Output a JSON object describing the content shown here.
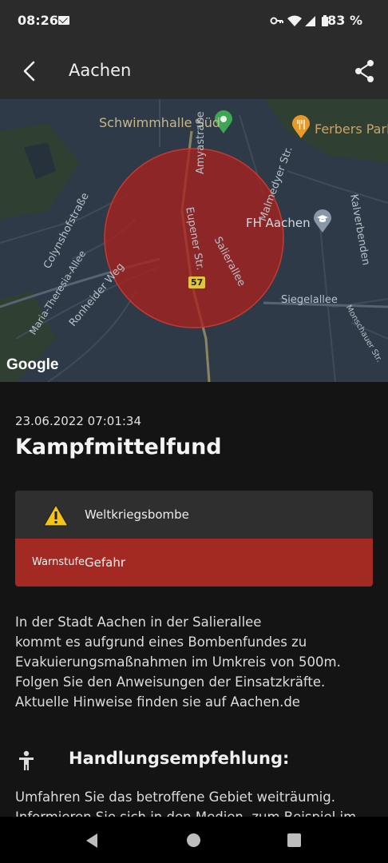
{
  "status_bar": {
    "time": "08:26",
    "battery": "83 %"
  },
  "app_bar": {
    "title": "Aachen"
  },
  "map": {
    "labels": {
      "schwimmhalle": "Schwimmhalle Süd",
      "ferbers": "Ferbers Park",
      "fh": "FH Aachen",
      "amyastrasse": "Amyastraße",
      "malmedyer": "Malmedyer Str.",
      "kalverbenden": "Kalverbenden",
      "colynshof": "Colynshofstraße",
      "maria_theresia": "Maria-Theresia-Allee",
      "ronheider": "Ronheider Weg",
      "eupener": "Eupener Str.",
      "salierallee": "Salierallee",
      "siegelallee": "Siegelallee",
      "monschauer": "Monschauer Str.",
      "route": "57"
    },
    "attribution": "Google",
    "colors": {
      "zone": "#a8221f",
      "background": "#2e3a47"
    }
  },
  "alert": {
    "timestamp": "23.06.2022 07:01:34",
    "title": "Kampfmittelfund",
    "type_label": "Weltkriegsbombe",
    "level_label": "Warnstufe",
    "level_value": "Gefahr",
    "level_color": "#a22a23",
    "description": [
      "In der Stadt Aachen in der Salierallee",
      "kommt es aufgrund eines Bombenfundes zu",
      "Evakuierungsmaßnahmen im Umkreis von 500m.",
      "Folgen Sie den Anweisungen der Einsatzkräfte.",
      "Aktuelle Hinweise finden sie auf Aachen.de"
    ]
  },
  "recommendation": {
    "title": "Handlungsempfehlung:",
    "text": [
      "Umfahren Sie das betroffene Gebiet weiträumig.",
      "Informieren Sie sich in den Medien, zum Beispiel im"
    ]
  },
  "icons": [
    "mail-icon",
    "key-icon",
    "wifi-icon",
    "signal-icon",
    "battery-icon",
    "back-arrow-icon",
    "share-icon",
    "pin-icon",
    "restaurant-pin-icon",
    "school-pin-icon",
    "warning-triangle-icon",
    "person-icon",
    "nav-back-icon",
    "nav-home-icon",
    "nav-recents-icon"
  ]
}
